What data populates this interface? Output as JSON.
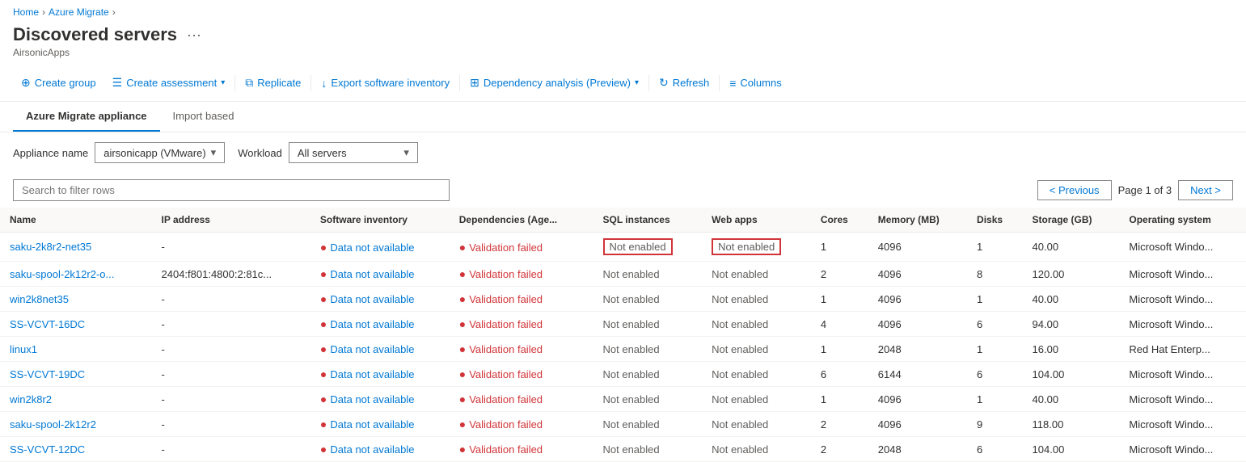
{
  "breadcrumb": {
    "items": [
      "Home",
      "Azure Migrate"
    ]
  },
  "page": {
    "title": "Discovered servers",
    "subtitle": "AirsonicApps"
  },
  "toolbar": {
    "buttons": [
      {
        "id": "create-group",
        "label": "Create group",
        "icon": "⊕"
      },
      {
        "id": "create-assessment",
        "label": "Create assessment",
        "icon": "☰",
        "hasDropdown": true
      },
      {
        "id": "replicate",
        "label": "Replicate",
        "icon": "⧉"
      },
      {
        "id": "export",
        "label": "Export software inventory",
        "icon": "↓"
      },
      {
        "id": "dependency",
        "label": "Dependency analysis (Preview)",
        "icon": "⊞",
        "hasDropdown": true
      },
      {
        "id": "refresh",
        "label": "Refresh",
        "icon": "↻"
      },
      {
        "id": "columns",
        "label": "Columns",
        "icon": "⊞"
      }
    ]
  },
  "tabs": [
    {
      "id": "azure-migrate",
      "label": "Azure Migrate appliance",
      "active": true
    },
    {
      "id": "import-based",
      "label": "Import based",
      "active": false
    }
  ],
  "filters": {
    "appliance": {
      "label": "Appliance name",
      "value": "airsonicapp (VMware)"
    },
    "workload": {
      "label": "Workload",
      "value": "All servers"
    }
  },
  "search": {
    "placeholder": "Search to filter rows"
  },
  "pagination": {
    "previous": "< Previous",
    "next": "Next >",
    "page_info": "Page 1 of 3"
  },
  "table": {
    "columns": [
      "Name",
      "IP address",
      "Software inventory",
      "Dependencies (Age...",
      "SQL instances",
      "Web apps",
      "Cores",
      "Memory (MB)",
      "Disks",
      "Storage (GB)",
      "Operating system"
    ],
    "rows": [
      {
        "name": "saku-2k8r2-net35",
        "ip": "-",
        "software_inventory": "Data not available",
        "dependencies": "Validation failed",
        "sql_instances": "Not enabled",
        "web_apps": "Not enabled",
        "cores": "1",
        "memory": "4096",
        "disks": "1",
        "storage": "40.00",
        "os": "Microsoft Windo...",
        "highlight_sql": true
      },
      {
        "name": "saku-spool-2k12r2-o...",
        "ip": "2404:f801:4800:2:81c...",
        "software_inventory": "Data not available",
        "dependencies": "Validation failed",
        "sql_instances": "Not enabled",
        "web_apps": "Not enabled",
        "cores": "2",
        "memory": "4096",
        "disks": "8",
        "storage": "120.00",
        "os": "Microsoft Windo...",
        "highlight_sql": false
      },
      {
        "name": "win2k8net35",
        "ip": "-",
        "software_inventory": "Data not available",
        "dependencies": "Validation failed",
        "sql_instances": "Not enabled",
        "web_apps": "Not enabled",
        "cores": "1",
        "memory": "4096",
        "disks": "1",
        "storage": "40.00",
        "os": "Microsoft Windo...",
        "highlight_sql": false
      },
      {
        "name": "SS-VCVT-16DC",
        "ip": "-",
        "software_inventory": "Data not available",
        "dependencies": "Validation failed",
        "sql_instances": "Not enabled",
        "web_apps": "Not enabled",
        "cores": "4",
        "memory": "4096",
        "disks": "6",
        "storage": "94.00",
        "os": "Microsoft Windo...",
        "highlight_sql": false
      },
      {
        "name": "linux1",
        "ip": "-",
        "software_inventory": "Data not available",
        "dependencies": "Validation failed",
        "sql_instances": "Not enabled",
        "web_apps": "Not enabled",
        "cores": "1",
        "memory": "2048",
        "disks": "1",
        "storage": "16.00",
        "os": "Red Hat Enterp...",
        "highlight_sql": false
      },
      {
        "name": "SS-VCVT-19DC",
        "ip": "-",
        "software_inventory": "Data not available",
        "dependencies": "Validation failed",
        "sql_instances": "Not enabled",
        "web_apps": "Not enabled",
        "cores": "6",
        "memory": "6144",
        "disks": "6",
        "storage": "104.00",
        "os": "Microsoft Windo...",
        "highlight_sql": false
      },
      {
        "name": "win2k8r2",
        "ip": "-",
        "software_inventory": "Data not available",
        "dependencies": "Validation failed",
        "sql_instances": "Not enabled",
        "web_apps": "Not enabled",
        "cores": "1",
        "memory": "4096",
        "disks": "1",
        "storage": "40.00",
        "os": "Microsoft Windo...",
        "highlight_sql": false
      },
      {
        "name": "saku-spool-2k12r2",
        "ip": "-",
        "software_inventory": "Data not available",
        "dependencies": "Validation failed",
        "sql_instances": "Not enabled",
        "web_apps": "Not enabled",
        "cores": "2",
        "memory": "4096",
        "disks": "9",
        "storage": "118.00",
        "os": "Microsoft Windo...",
        "highlight_sql": false
      },
      {
        "name": "SS-VCVT-12DC",
        "ip": "-",
        "software_inventory": "Data not available",
        "dependencies": "Validation failed",
        "sql_instances": "Not enabled",
        "web_apps": "Not enabled",
        "cores": "2",
        "memory": "2048",
        "disks": "6",
        "storage": "104.00",
        "os": "Microsoft Windo...",
        "highlight_sql": false
      }
    ]
  }
}
